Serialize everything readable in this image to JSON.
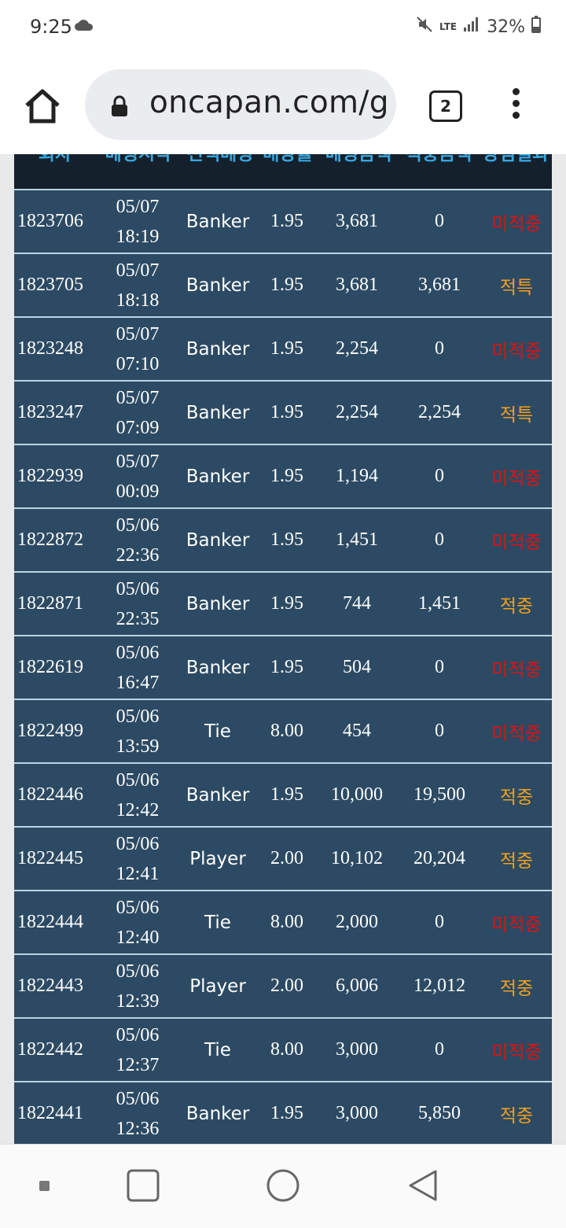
{
  "status_bar": {
    "time": "9:25",
    "network": "LTE",
    "battery": "32%",
    "icons": [
      "cloud-icon",
      "mute-icon",
      "signal-icon",
      "battery-icon"
    ]
  },
  "browser": {
    "url": "oncapan.com/g",
    "tab_count": "2",
    "icons": [
      "home-icon",
      "lock-icon",
      "tabs-icon",
      "menu-icon"
    ]
  },
  "table": {
    "headers": [
      "회차",
      "베팅시각",
      "선택베팅",
      "배당률",
      "베팅금액",
      "적중금액",
      "당첨결과"
    ],
    "rows": [
      {
        "round": "1823706",
        "date": "05/07",
        "time": "18:19",
        "pick": "Banker",
        "odds": "1.95",
        "bet": "3,681",
        "win": "0",
        "result": "미적중",
        "status": "lose"
      },
      {
        "round": "1823705",
        "date": "05/07",
        "time": "18:18",
        "pick": "Banker",
        "odds": "1.95",
        "bet": "3,681",
        "win": "3,681",
        "result": "적특",
        "status": "win"
      },
      {
        "round": "1823248",
        "date": "05/07",
        "time": "07:10",
        "pick": "Banker",
        "odds": "1.95",
        "bet": "2,254",
        "win": "0",
        "result": "미적중",
        "status": "lose"
      },
      {
        "round": "1823247",
        "date": "05/07",
        "time": "07:09",
        "pick": "Banker",
        "odds": "1.95",
        "bet": "2,254",
        "win": "2,254",
        "result": "적특",
        "status": "win"
      },
      {
        "round": "1822939",
        "date": "05/07",
        "time": "00:09",
        "pick": "Banker",
        "odds": "1.95",
        "bet": "1,194",
        "win": "0",
        "result": "미적중",
        "status": "lose"
      },
      {
        "round": "1822872",
        "date": "05/06",
        "time": "22:36",
        "pick": "Banker",
        "odds": "1.95",
        "bet": "1,451",
        "win": "0",
        "result": "미적중",
        "status": "lose"
      },
      {
        "round": "1822871",
        "date": "05/06",
        "time": "22:35",
        "pick": "Banker",
        "odds": "1.95",
        "bet": "744",
        "win": "1,451",
        "result": "적중",
        "status": "win"
      },
      {
        "round": "1822619",
        "date": "05/06",
        "time": "16:47",
        "pick": "Banker",
        "odds": "1.95",
        "bet": "504",
        "win": "0",
        "result": "미적중",
        "status": "lose"
      },
      {
        "round": "1822499",
        "date": "05/06",
        "time": "13:59",
        "pick": "Tie",
        "odds": "8.00",
        "bet": "454",
        "win": "0",
        "result": "미적중",
        "status": "lose"
      },
      {
        "round": "1822446",
        "date": "05/06",
        "time": "12:42",
        "pick": "Banker",
        "odds": "1.95",
        "bet": "10,000",
        "win": "19,500",
        "result": "적중",
        "status": "win"
      },
      {
        "round": "1822445",
        "date": "05/06",
        "time": "12:41",
        "pick": "Player",
        "odds": "2.00",
        "bet": "10,102",
        "win": "20,204",
        "result": "적중",
        "status": "win"
      },
      {
        "round": "1822444",
        "date": "05/06",
        "time": "12:40",
        "pick": "Tie",
        "odds": "8.00",
        "bet": "2,000",
        "win": "0",
        "result": "미적중",
        "status": "lose"
      },
      {
        "round": "1822443",
        "date": "05/06",
        "time": "12:39",
        "pick": "Player",
        "odds": "2.00",
        "bet": "6,006",
        "win": "12,012",
        "result": "적중",
        "status": "win"
      },
      {
        "round": "1822442",
        "date": "05/06",
        "time": "12:37",
        "pick": "Tie",
        "odds": "8.00",
        "bet": "3,000",
        "win": "0",
        "result": "미적중",
        "status": "lose"
      },
      {
        "round": "1822441",
        "date": "05/06",
        "time": "12:36",
        "pick": "Banker",
        "odds": "1.95",
        "bet": "3,000",
        "win": "5,850",
        "result": "적중",
        "status": "win"
      }
    ]
  },
  "scroll_top": {
    "icon": "arrow-up-icon"
  },
  "nav_bar": {
    "icons": [
      "recents-dot-icon",
      "overview-icon",
      "home-circle-icon",
      "back-icon"
    ]
  },
  "colors": {
    "lose": "#e01010",
    "win": "#f0a020",
    "header_text": "#38a6e0",
    "row_bg": "#2c4a63"
  }
}
